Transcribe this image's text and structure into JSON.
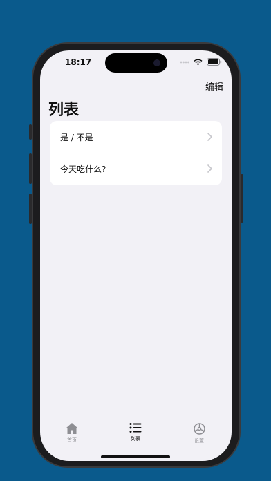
{
  "status_bar": {
    "time": "18:17"
  },
  "nav": {
    "edit_label": "编辑"
  },
  "page": {
    "title": "列表"
  },
  "list": {
    "items": [
      {
        "label": "是 / 不是",
        "icon": "chevron-right-icon"
      },
      {
        "label": "今天吃什么?",
        "icon": "chevron-right-icon"
      }
    ]
  },
  "tab_bar": {
    "tabs": [
      {
        "label": "首页",
        "icon": "home-icon",
        "active": false
      },
      {
        "label": "列表",
        "icon": "list-icon",
        "active": true
      },
      {
        "label": "设置",
        "icon": "gear-icon",
        "active": false
      }
    ]
  },
  "colors": {
    "background": "#0a5a8c",
    "screen": "#f2f1f6",
    "card": "#ffffff",
    "active_tab": "#111111",
    "inactive_tab": "#8e8e93"
  }
}
